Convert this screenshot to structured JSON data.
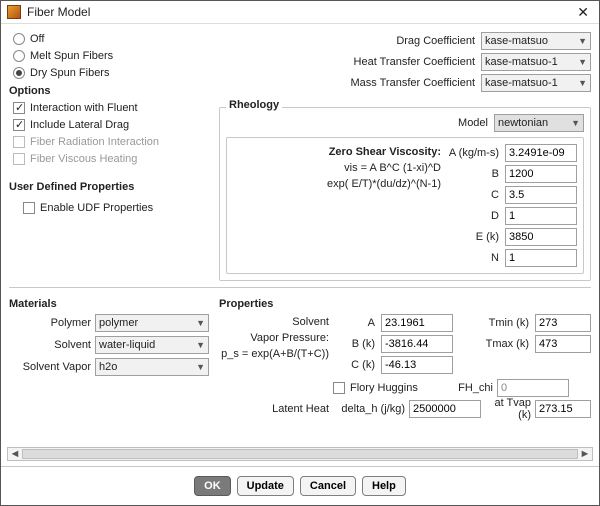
{
  "window": {
    "title": "Fiber Model"
  },
  "mode": {
    "items": [
      "Off",
      "Melt Spun Fibers",
      "Dry Spun Fibers"
    ],
    "selected": 2
  },
  "options": {
    "header": "Options",
    "items": [
      "Interaction with Fluent",
      "Include Lateral Drag",
      "Fiber Radiation Interaction",
      "Fiber Viscous Heating"
    ],
    "checked": [
      true,
      true,
      false,
      false
    ],
    "enabled": [
      true,
      true,
      false,
      false
    ]
  },
  "udf": {
    "header": "User Defined Properties",
    "enable": "Enable UDF Properties",
    "checked": false
  },
  "coeffs": {
    "drag": {
      "label": "Drag Coefficient",
      "value": "kase-matsuo"
    },
    "heat": {
      "label": "Heat Transfer Coefficient",
      "value": "kase-matsuo-1"
    },
    "mass": {
      "label": "Mass Transfer Coefficient",
      "value": "kase-matsuo-1"
    }
  },
  "rheology": {
    "header": "Rheology",
    "model_label": "Model",
    "model_value": "newtonian",
    "eqs": [
      "Zero Shear Viscosity:",
      "vis = A B^C (1-xi)^D",
      "exp( E/T)*(du/dz)^(N-1)"
    ],
    "params": [
      {
        "label": "A (kg/m-s)",
        "value": "3.2491e-09"
      },
      {
        "label": "B",
        "value": "1200"
      },
      {
        "label": "C",
        "value": "3.5"
      },
      {
        "label": "D",
        "value": "1"
      },
      {
        "label": "E (k)",
        "value": "3850"
      },
      {
        "label": "N",
        "value": "1"
      }
    ]
  },
  "materials": {
    "header": "Materials",
    "items": [
      {
        "label": "Polymer",
        "value": "polymer"
      },
      {
        "label": "Solvent",
        "value": "water-liquid"
      },
      {
        "label": "Solvent Vapor",
        "value": "h2o"
      }
    ]
  },
  "props": {
    "header": "Properties",
    "svp": [
      "Solvent",
      "Vapor Pressure:",
      "p_s = exp(A+B/(T+C))"
    ],
    "abc": [
      {
        "label": "A",
        "value": "23.1961"
      },
      {
        "label": "B (k)",
        "value": "-3816.44"
      },
      {
        "label": "C (k)",
        "value": "-46.13"
      }
    ],
    "t": [
      {
        "label": "Tmin (k)",
        "value": "273"
      },
      {
        "label": "Tmax (k)",
        "value": "473"
      }
    ],
    "flory": "Flory Huggins",
    "fh_label": "FH_chi",
    "fh_value": "0",
    "latent": {
      "label": "Latent Heat",
      "unit": "delta_h (j/kg)",
      "value": "2500000"
    },
    "tvap": {
      "label": "at Tvap (k)",
      "value": "273.15"
    }
  },
  "footer": {
    "ok": "OK",
    "update": "Update",
    "cancel": "Cancel",
    "help": "Help"
  }
}
